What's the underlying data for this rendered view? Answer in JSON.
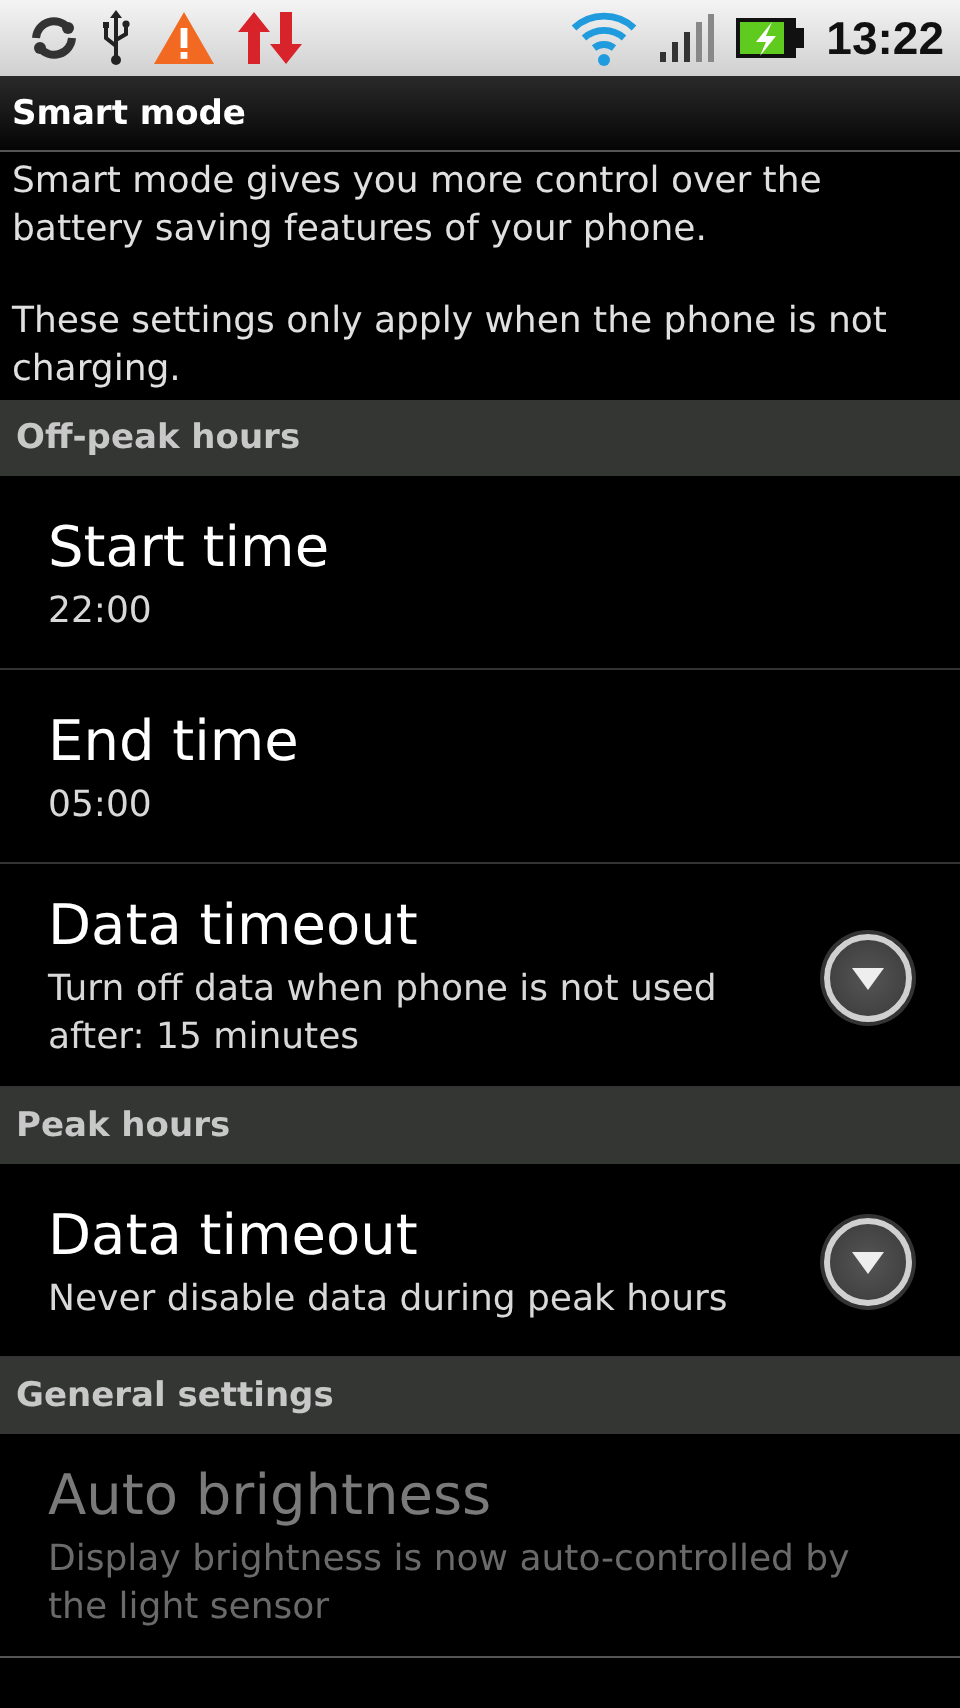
{
  "status_bar": {
    "time": "13:22"
  },
  "title": "Smart mode",
  "description": [
    "Smart mode gives you more control over the battery saving features of your phone.",
    "These settings only apply when the phone is not charging."
  ],
  "sections": [
    {
      "header": "Off-peak hours",
      "items": [
        {
          "kind": "plain",
          "title": "Start time",
          "summary": "22:00",
          "disabled": false
        },
        {
          "kind": "plain",
          "title": "End time",
          "summary": "05:00",
          "disabled": false
        },
        {
          "kind": "dropdown",
          "title": "Data timeout",
          "summary": "Turn off data when phone is not used after: 15 minutes",
          "disabled": false
        }
      ]
    },
    {
      "header": "Peak hours",
      "items": [
        {
          "kind": "dropdown",
          "title": "Data timeout",
          "summary": "Never disable data during peak hours",
          "disabled": false
        }
      ]
    },
    {
      "header": "General settings",
      "items": [
        {
          "kind": "plain",
          "title": "Auto brightness",
          "summary": "Display brightness is now auto-controlled by the light sensor",
          "disabled": true
        }
      ]
    }
  ]
}
